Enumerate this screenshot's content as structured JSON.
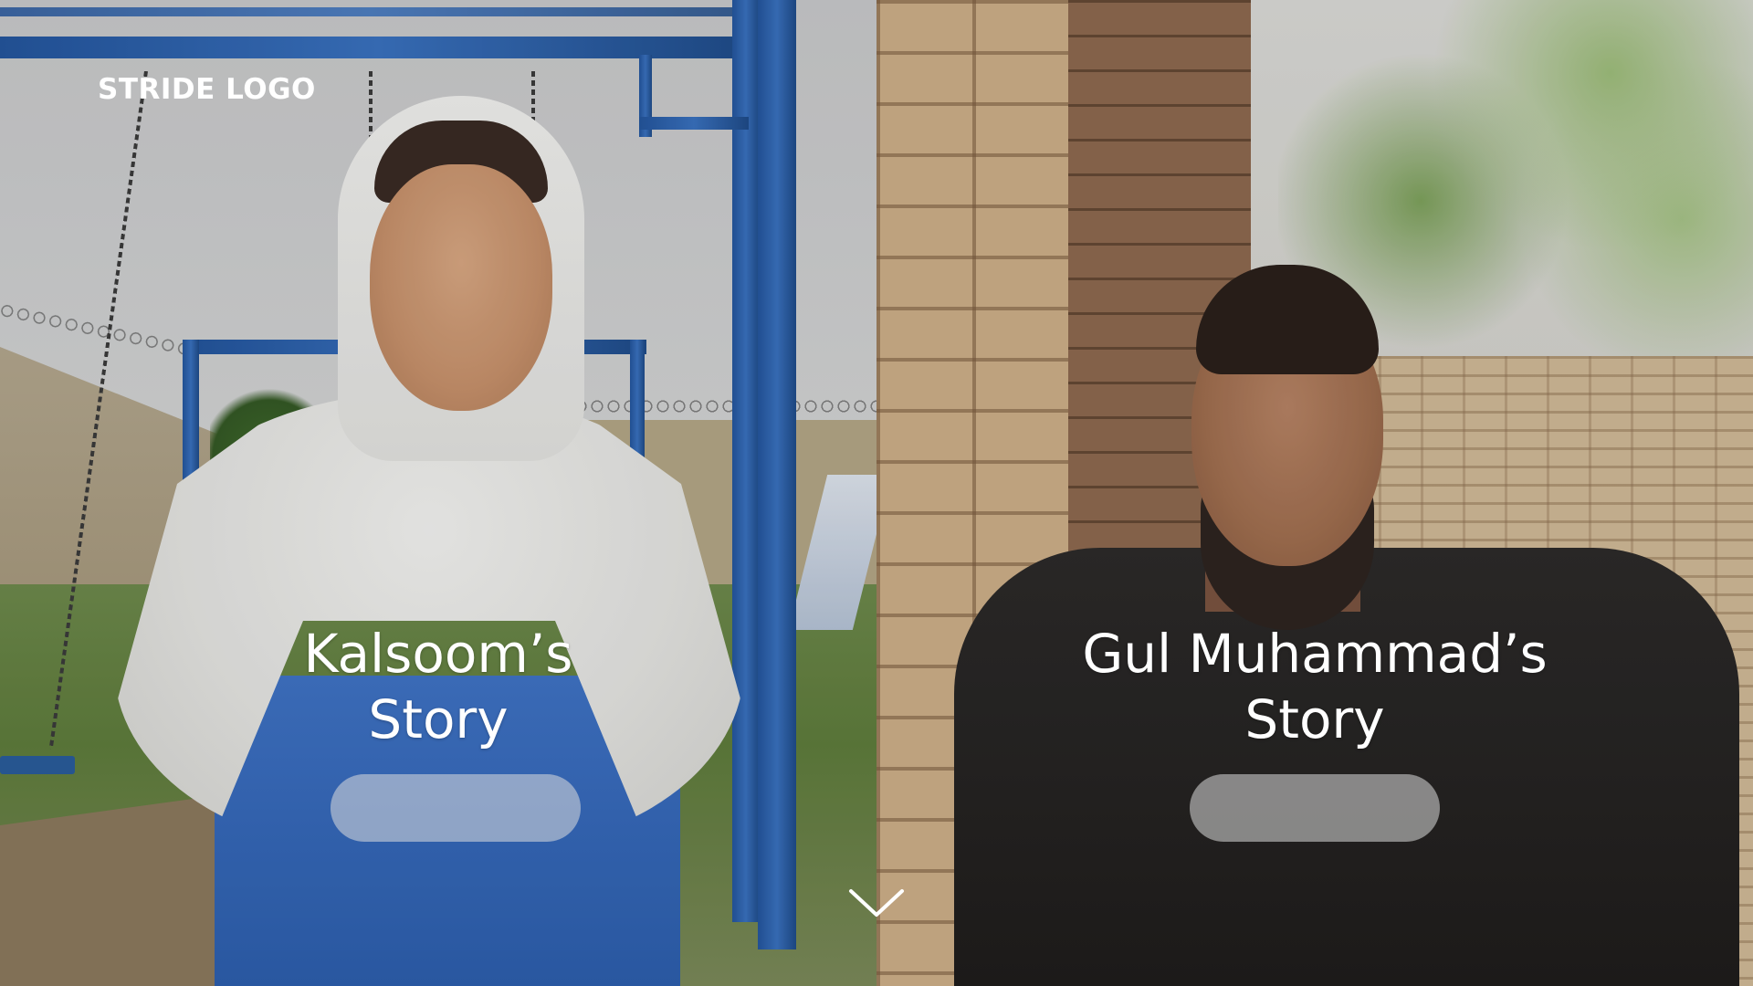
{
  "header": {
    "logo_text": "STRIDE LOGO"
  },
  "stories": [
    {
      "title_line1": "Kalsoom’s",
      "title_line2": "Story",
      "button_label": ""
    },
    {
      "title_line1": "Gul Muhammad’s",
      "title_line2": "Story",
      "button_label": ""
    }
  ],
  "scroll": {
    "icon": "chevron-down-icon"
  },
  "colors": {
    "text": "#ffffff",
    "button_fill": "rgba(220,220,220,0.55)"
  }
}
